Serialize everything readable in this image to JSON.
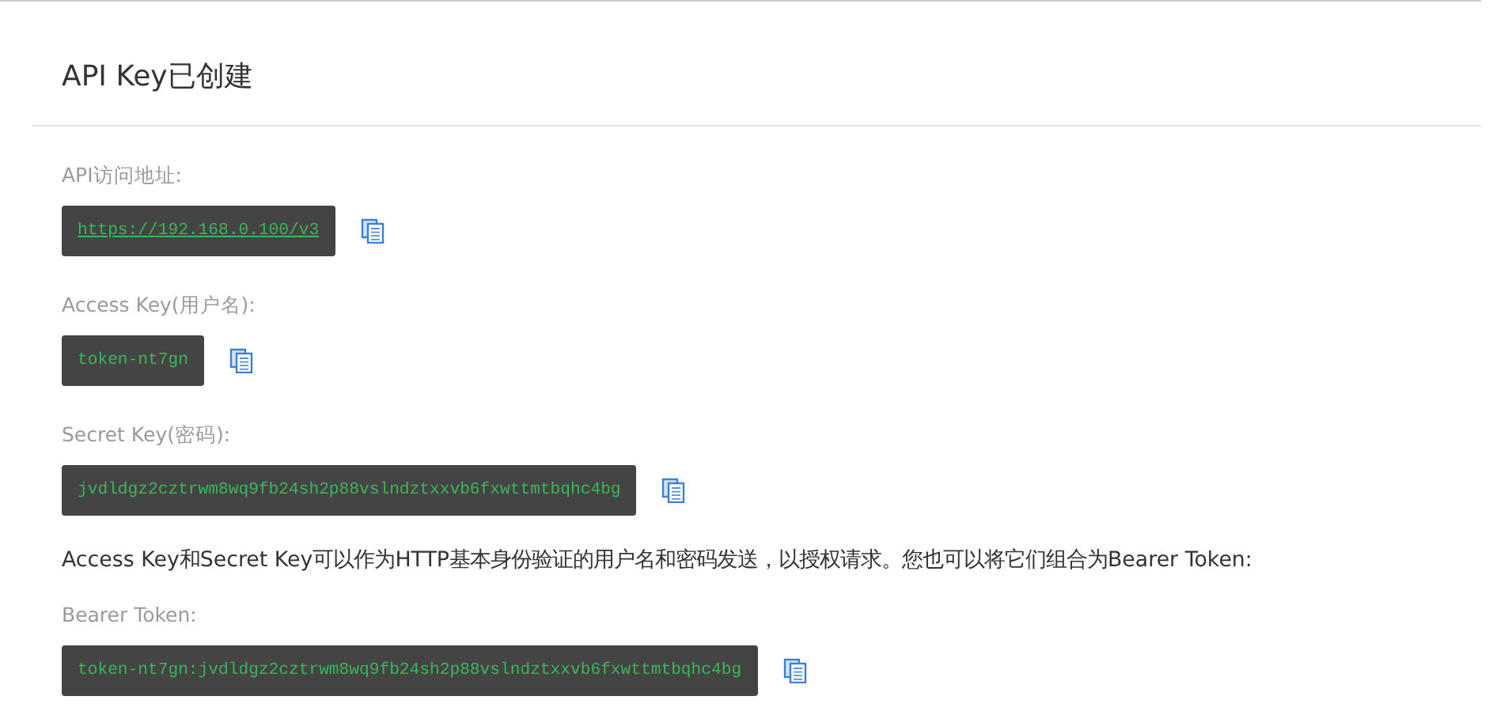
{
  "title": "API Key已创建",
  "fields": [
    {
      "label": "API访问地址:",
      "value": "https://192.168.0.100/v3",
      "link": true
    },
    {
      "label": "Access Key(用户名):",
      "value": "token-nt7gn",
      "link": false
    },
    {
      "label": "Secret Key(密码):",
      "value": "jvdldgz2cztrwm8wq9fb24sh2p88vslndztxxvb6fxwttmtbqhc4bg",
      "link": false
    }
  ],
  "note": "Access Key和Secret Key可以作为HTTP基本身份验证的用户名和密码发送，以授权请求。您也可以将它们组合为Bearer Token:",
  "bearer": {
    "label": "Bearer Token:",
    "value": "token-nt7gn:jvdldgz2cztrwm8wq9fb24sh2p88vslndztxxvb6fxwttmtbqhc4bg",
    "link": false
  }
}
